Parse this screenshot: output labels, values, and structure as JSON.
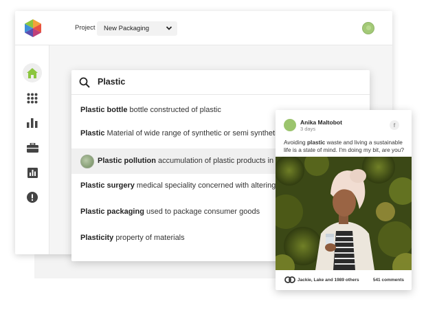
{
  "header": {
    "project_label": "Project",
    "project_value": "New Packaging"
  },
  "sidebar": {
    "items": [
      {
        "icon": "home-icon",
        "active": true
      },
      {
        "icon": "apps-grid-icon",
        "active": false
      },
      {
        "icon": "bar-chart-icon",
        "active": false
      },
      {
        "icon": "briefcase-icon",
        "active": false
      },
      {
        "icon": "report-icon",
        "active": false
      },
      {
        "icon": "alert-icon",
        "active": false
      }
    ]
  },
  "search": {
    "query": "Plastic",
    "results": [
      {
        "term": "Plastic bottle",
        "description": " bottle constructed of plastic",
        "thumb": false
      },
      {
        "term": "Plastic",
        "description": " Material of wide range of synthetic or semi synthetic",
        "thumb": false
      },
      {
        "term": "Plastic pollution",
        "description": " accumulation of plastic products in the",
        "thumb": true
      },
      {
        "term": "Plastic surgery",
        "description": " medical speciality concerned with altering",
        "thumb": false
      },
      {
        "term": "Plastic packaging",
        "description": " used to package consumer goods",
        "thumb": false
      },
      {
        "term": "Plasticity",
        "description": " property of materials",
        "thumb": false
      }
    ]
  },
  "post": {
    "author": "Anika Maltobot",
    "time": "3 days",
    "network_icon": "f",
    "text_before": "Avoiding ",
    "text_bold": "plastic",
    "text_after": " waste and living a sustainable life is a state of mind. I'm doing my bit, are you?",
    "reactions": "Jackie, Lake and 1989 others",
    "comments": "541 comments"
  },
  "colors": {
    "accent_green": "#8cc63f",
    "highlight_row": "#f0f0f0"
  }
}
